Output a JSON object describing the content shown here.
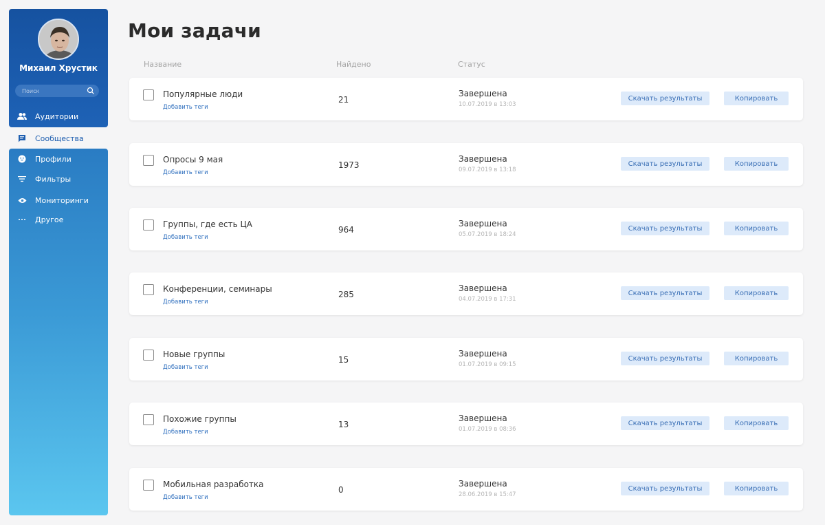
{
  "user": {
    "name": "Михаил Хрустик"
  },
  "search": {
    "placeholder": "Поиск"
  },
  "nav": [
    {
      "label": "Аудитории",
      "icon": "users-icon"
    },
    {
      "label": "Сообщества",
      "icon": "chat-icon"
    },
    {
      "label": "Профили",
      "icon": "smile-icon"
    },
    {
      "label": "Фильтры",
      "icon": "filter-icon"
    },
    {
      "label": "Мониторинги",
      "icon": "eye-icon"
    },
    {
      "label": "Другое",
      "icon": "more-icon"
    }
  ],
  "page": {
    "title": "Мои задачи"
  },
  "columns": {
    "name": "Название",
    "found": "Найдено",
    "status": "Статус"
  },
  "tasks": [
    {
      "name": "Популярные люди",
      "tags": "Добавить теги",
      "found": "21",
      "status": "Завершена",
      "date": "10.07.2019 в 13:03",
      "download": "Скачать результаты",
      "copy": "Копировать"
    },
    {
      "name": "Опросы 9 мая",
      "tags": "Добавить теги",
      "found": "1973",
      "status": "Завершена",
      "date": "09.07.2019 в 13:18",
      "download": "Скачать результаты",
      "copy": "Копировать"
    },
    {
      "name": "Группы, где есть ЦА",
      "tags": "Добавить теги",
      "found": "964",
      "status": "Завершена",
      "date": "05.07.2019 в 18:24",
      "download": "Скачать результаты",
      "copy": "Копировать"
    },
    {
      "name": "Конференции, семинары",
      "tags": "Добавить теги",
      "found": "285",
      "status": "Завершена",
      "date": "04.07.2019 в 17:31",
      "download": "Скачать результаты",
      "copy": "Копировать"
    },
    {
      "name": "Новые группы",
      "tags": "Добавить теги",
      "found": "15",
      "status": "Завершена",
      "date": "01.07.2019 в 09:15",
      "download": "Скачать результаты",
      "copy": "Копировать"
    },
    {
      "name": "Похожие группы",
      "tags": "Добавить теги",
      "found": "13",
      "status": "Завершена",
      "date": "01.07.2019 в 08:36",
      "download": "Скачать результаты",
      "copy": "Копировать"
    },
    {
      "name": "Мобильная разработка",
      "tags": "Добавить теги",
      "found": "0",
      "status": "Завершена",
      "date": "28.06.2019 в 15:47",
      "download": "Скачать результаты",
      "copy": "Копировать"
    }
  ],
  "colors": {
    "sidebar_top": "#1652a0",
    "sidebar_bottom": "#5bc6ef",
    "accent": "#2f6fbe",
    "button_bg": "#ddeafa"
  }
}
